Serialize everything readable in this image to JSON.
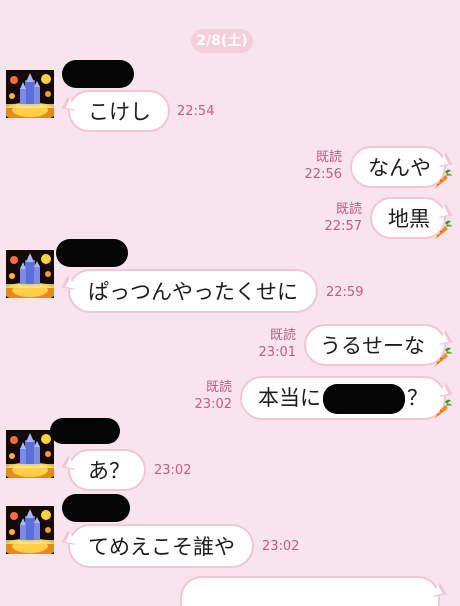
{
  "date_label": "2/8(土)",
  "messages": [
    {
      "side": "in",
      "text": "こけし",
      "time": "22:54"
    },
    {
      "side": "out",
      "text": "なんや",
      "time": "22:56",
      "read": "既読"
    },
    {
      "side": "out",
      "text": "地黒",
      "time": "22:57",
      "read": "既読"
    },
    {
      "side": "in",
      "text": "ぱっつんやったくせに",
      "time": "22:59"
    },
    {
      "side": "out",
      "text": "うるせーな",
      "time": "23:01",
      "read": "既読"
    },
    {
      "side": "out",
      "text_before": "本当に",
      "text_after": "？",
      "time": "23:02",
      "read": "既読"
    },
    {
      "side": "in",
      "text": "あ？",
      "time": "23:02"
    },
    {
      "side": "in",
      "text": "てめえこそ誰や",
      "time": "23:02"
    }
  ],
  "colors": {
    "background": "#f8e4ec",
    "bubble_border": "#f2c6d6",
    "meta_text": "#c45a88",
    "date_pill": "#f3cfdc"
  },
  "icons": [
    "avatar-fireworks-castle",
    "carrot-icon"
  ]
}
